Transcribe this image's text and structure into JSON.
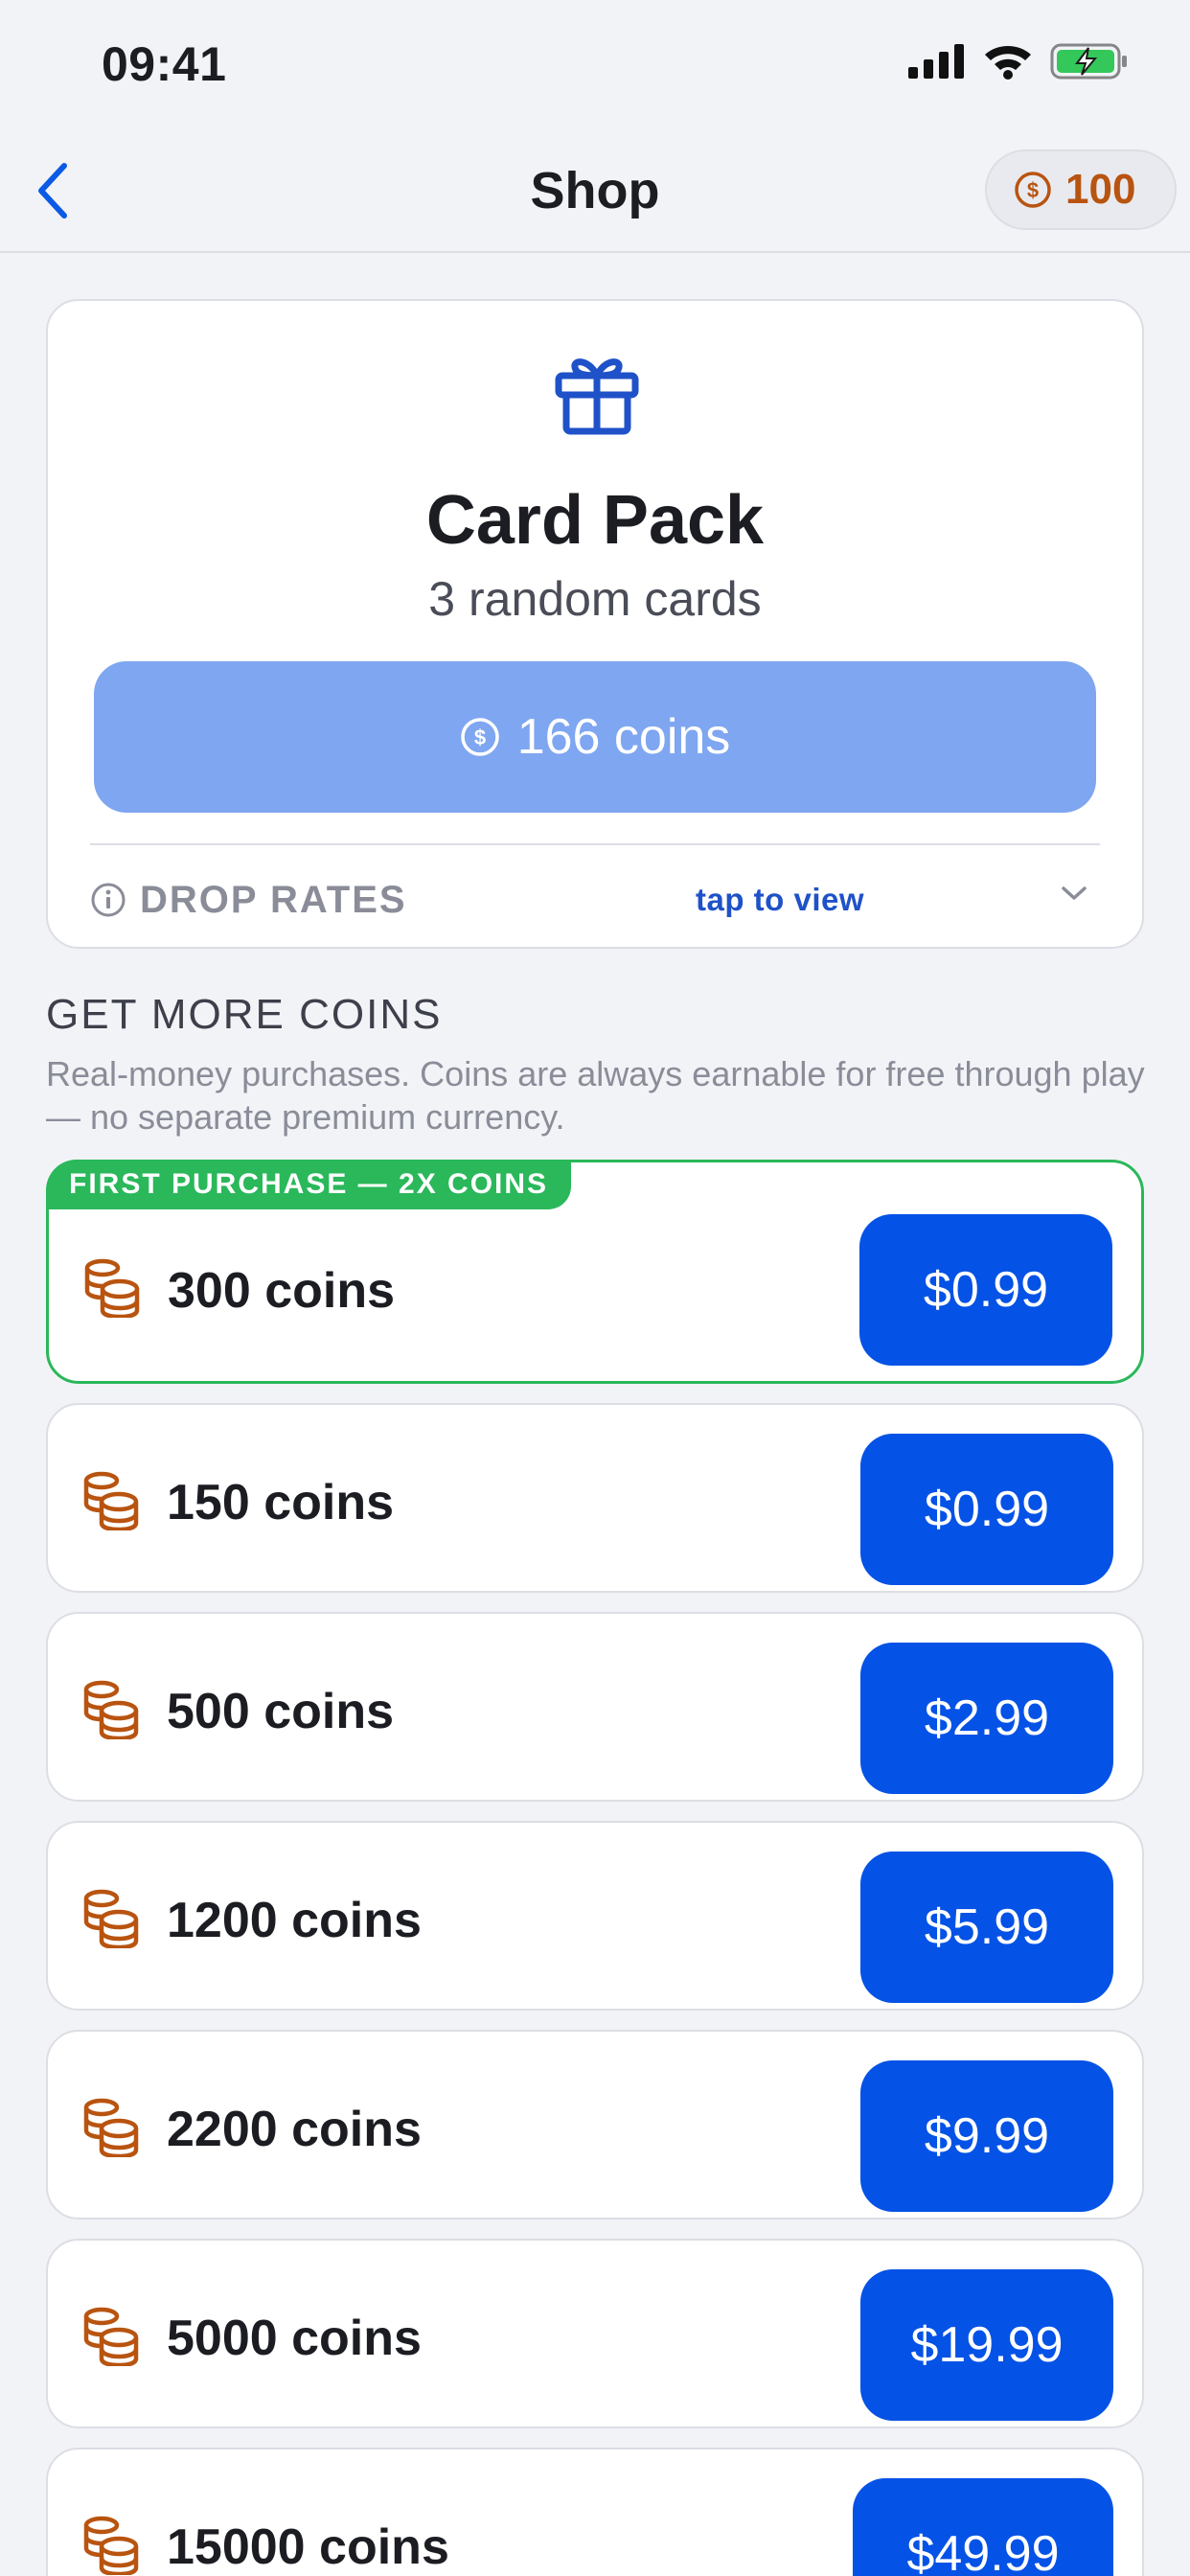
{
  "status": {
    "time": "09:41"
  },
  "nav": {
    "title": "Shop",
    "balance": "100"
  },
  "pack": {
    "title": "Card Pack",
    "subtitle": "3 random cards",
    "buy_label": "166 coins",
    "drop_rates_label": "DROP RATES",
    "drop_rates_hint": "tap to view"
  },
  "coins_section": {
    "title": "GET MORE COINS",
    "description": "Real-money purchases. Coins are always earnable for free through play — no separate premium currency."
  },
  "offers": [
    {
      "badge": "FIRST PURCHASE — 2X COINS",
      "label": "300 coins",
      "price": "$0.99"
    },
    {
      "label": "150 coins",
      "price": "$0.99"
    },
    {
      "label": "500 coins",
      "price": "$2.99"
    },
    {
      "label": "1200 coins",
      "price": "$5.99"
    },
    {
      "label": "2200 coins",
      "price": "$9.99"
    },
    {
      "label": "5000 coins",
      "price": "$19.99"
    },
    {
      "label": "15000 coins",
      "price": "$49.99"
    }
  ],
  "colors": {
    "accent": "#0452e6",
    "accent_disabled": "#7fa6f0",
    "coin": "#b85410",
    "featured": "#2ab85a",
    "background": "#f2f3f7"
  },
  "icons": {
    "back": "chevron-left-icon",
    "balance": "dollar-coin-icon",
    "pack": "gift-icon",
    "info": "info-icon",
    "expand": "chevron-down-icon",
    "coins": "coin-stack-icon"
  }
}
